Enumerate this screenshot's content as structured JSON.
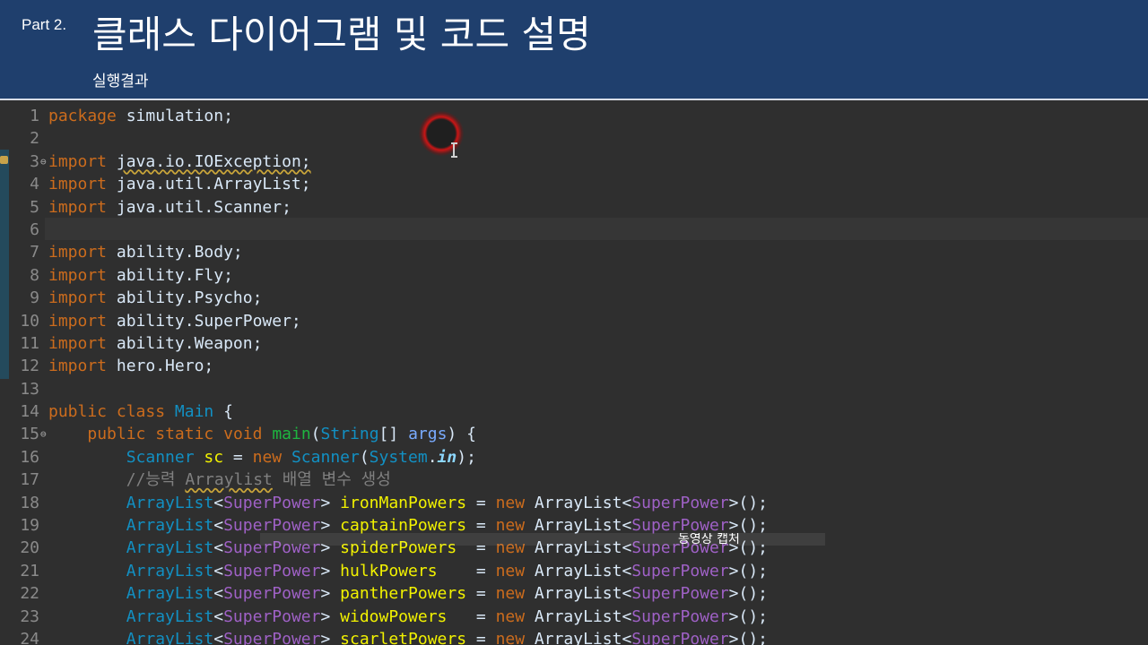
{
  "header": {
    "part_label": "Part 2.",
    "title": "클래스 다이어그램 및 코드 설명",
    "subtitle": "실행결과"
  },
  "caption": "동영상 캡처",
  "colors": {
    "header_bg": "#1f3f6d",
    "editor_bg": "#2f2f2f",
    "keyword": "#cc6c1d",
    "class_name": "#1290c3",
    "generic": "#9f61c6",
    "method": "#1eb540",
    "variable": "#f2f200",
    "comment": "#808080"
  },
  "code_lines": [
    {
      "n": "1",
      "tokens": [
        {
          "t": "package",
          "c": "kw"
        },
        {
          "t": " simulation;",
          "c": "plain"
        }
      ]
    },
    {
      "n": "2",
      "tokens": []
    },
    {
      "n": "3",
      "fold": "⊖",
      "tokens": [
        {
          "t": "import",
          "c": "kw"
        },
        {
          "t": " ",
          "c": "plain"
        },
        {
          "t": "java.io.IOException;",
          "c": "plain warn"
        }
      ]
    },
    {
      "n": "4",
      "tokens": [
        {
          "t": "import",
          "c": "kw"
        },
        {
          "t": " java.util.ArrayList;",
          "c": "plain"
        }
      ]
    },
    {
      "n": "5",
      "tokens": [
        {
          "t": "import",
          "c": "kw"
        },
        {
          "t": " java.util.Scanner;",
          "c": "plain"
        }
      ]
    },
    {
      "n": "6",
      "tokens": []
    },
    {
      "n": "7",
      "tokens": [
        {
          "t": "import",
          "c": "kw"
        },
        {
          "t": " ability.Body;",
          "c": "plain"
        }
      ]
    },
    {
      "n": "8",
      "tokens": [
        {
          "t": "import",
          "c": "kw"
        },
        {
          "t": " ability.Fly;",
          "c": "plain"
        }
      ]
    },
    {
      "n": "9",
      "tokens": [
        {
          "t": "import",
          "c": "kw"
        },
        {
          "t": " ability.Psycho;",
          "c": "plain"
        }
      ]
    },
    {
      "n": "10",
      "tokens": [
        {
          "t": "import",
          "c": "kw"
        },
        {
          "t": " ability.SuperPower;",
          "c": "plain"
        }
      ]
    },
    {
      "n": "11",
      "tokens": [
        {
          "t": "import",
          "c": "kw"
        },
        {
          "t": " ability.Weapon;",
          "c": "plain"
        }
      ]
    },
    {
      "n": "12",
      "tokens": [
        {
          "t": "import",
          "c": "kw"
        },
        {
          "t": " hero.Hero;",
          "c": "plain"
        }
      ]
    },
    {
      "n": "13",
      "tokens": []
    },
    {
      "n": "14",
      "tokens": [
        {
          "t": "public",
          "c": "kw"
        },
        {
          "t": " ",
          "c": "plain"
        },
        {
          "t": "class",
          "c": "kw"
        },
        {
          "t": " ",
          "c": "plain"
        },
        {
          "t": "Main",
          "c": "cls"
        },
        {
          "t": " {",
          "c": "plain"
        }
      ]
    },
    {
      "n": "15",
      "fold": "⊖",
      "tokens": [
        {
          "t": "    ",
          "c": "plain"
        },
        {
          "t": "public",
          "c": "kw"
        },
        {
          "t": " ",
          "c": "plain"
        },
        {
          "t": "static",
          "c": "kw"
        },
        {
          "t": " ",
          "c": "plain"
        },
        {
          "t": "void",
          "c": "kw"
        },
        {
          "t": " ",
          "c": "plain"
        },
        {
          "t": "main",
          "c": "fn"
        },
        {
          "t": "(",
          "c": "plain"
        },
        {
          "t": "String",
          "c": "cls"
        },
        {
          "t": "[] ",
          "c": "plain"
        },
        {
          "t": "args",
          "c": "param"
        },
        {
          "t": ") {",
          "c": "plain"
        }
      ]
    },
    {
      "n": "16",
      "tokens": [
        {
          "t": "        ",
          "c": "plain"
        },
        {
          "t": "Scanner",
          "c": "cls"
        },
        {
          "t": " ",
          "c": "plain"
        },
        {
          "t": "sc",
          "c": "var"
        },
        {
          "t": " = ",
          "c": "plain"
        },
        {
          "t": "new",
          "c": "kw"
        },
        {
          "t": " ",
          "c": "plain"
        },
        {
          "t": "Scanner",
          "c": "cls"
        },
        {
          "t": "(",
          "c": "plain"
        },
        {
          "t": "System",
          "c": "cls"
        },
        {
          "t": ".",
          "c": "plain"
        },
        {
          "t": "in",
          "c": "field"
        },
        {
          "t": ");",
          "c": "plain"
        }
      ]
    },
    {
      "n": "17",
      "tokens": [
        {
          "t": "        ",
          "c": "plain"
        },
        {
          "t": "//능력 ",
          "c": "cmt"
        },
        {
          "t": "Arraylist",
          "c": "cmt warn"
        },
        {
          "t": " 배열 변수 생성",
          "c": "cmt"
        }
      ]
    },
    {
      "n": "18",
      "tokens": [
        {
          "t": "        ",
          "c": "plain"
        },
        {
          "t": "ArrayList",
          "c": "cls"
        },
        {
          "t": "<",
          "c": "plain"
        },
        {
          "t": "SuperPower",
          "c": "gen"
        },
        {
          "t": "> ",
          "c": "plain"
        },
        {
          "t": "ironManPowers",
          "c": "var"
        },
        {
          "t": " = ",
          "c": "plain"
        },
        {
          "t": "new",
          "c": "kw"
        },
        {
          "t": " ArrayList<",
          "c": "plain"
        },
        {
          "t": "SuperPower",
          "c": "gen"
        },
        {
          "t": ">();",
          "c": "plain"
        }
      ]
    },
    {
      "n": "19",
      "tokens": [
        {
          "t": "        ",
          "c": "plain"
        },
        {
          "t": "ArrayList",
          "c": "cls"
        },
        {
          "t": "<",
          "c": "plain"
        },
        {
          "t": "SuperPower",
          "c": "gen"
        },
        {
          "t": "> ",
          "c": "plain"
        },
        {
          "t": "captainPowers",
          "c": "var"
        },
        {
          "t": " = ",
          "c": "plain"
        },
        {
          "t": "new",
          "c": "kw"
        },
        {
          "t": " ArrayList<",
          "c": "plain"
        },
        {
          "t": "SuperPower",
          "c": "gen"
        },
        {
          "t": ">();",
          "c": "plain"
        }
      ]
    },
    {
      "n": "20",
      "tokens": [
        {
          "t": "        ",
          "c": "plain"
        },
        {
          "t": "ArrayList",
          "c": "cls"
        },
        {
          "t": "<",
          "c": "plain"
        },
        {
          "t": "SuperPower",
          "c": "gen"
        },
        {
          "t": "> ",
          "c": "plain"
        },
        {
          "t": "spiderPowers",
          "c": "var"
        },
        {
          "t": "  = ",
          "c": "plain"
        },
        {
          "t": "new",
          "c": "kw"
        },
        {
          "t": " ArrayList<",
          "c": "plain"
        },
        {
          "t": "SuperPower",
          "c": "gen"
        },
        {
          "t": ">();",
          "c": "plain"
        }
      ]
    },
    {
      "n": "21",
      "tokens": [
        {
          "t": "        ",
          "c": "plain"
        },
        {
          "t": "ArrayList",
          "c": "cls"
        },
        {
          "t": "<",
          "c": "plain"
        },
        {
          "t": "SuperPower",
          "c": "gen"
        },
        {
          "t": "> ",
          "c": "plain"
        },
        {
          "t": "hulkPowers",
          "c": "var"
        },
        {
          "t": "    = ",
          "c": "plain"
        },
        {
          "t": "new",
          "c": "kw"
        },
        {
          "t": " ArrayList<",
          "c": "plain"
        },
        {
          "t": "SuperPower",
          "c": "gen"
        },
        {
          "t": ">();",
          "c": "plain"
        }
      ]
    },
    {
      "n": "22",
      "tokens": [
        {
          "t": "        ",
          "c": "plain"
        },
        {
          "t": "ArrayList",
          "c": "cls"
        },
        {
          "t": "<",
          "c": "plain"
        },
        {
          "t": "SuperPower",
          "c": "gen"
        },
        {
          "t": "> ",
          "c": "plain"
        },
        {
          "t": "pantherPowers",
          "c": "var"
        },
        {
          "t": " = ",
          "c": "plain"
        },
        {
          "t": "new",
          "c": "kw"
        },
        {
          "t": " ArrayList<",
          "c": "plain"
        },
        {
          "t": "SuperPower",
          "c": "gen"
        },
        {
          "t": ">();",
          "c": "plain"
        }
      ]
    },
    {
      "n": "23",
      "tokens": [
        {
          "t": "        ",
          "c": "plain"
        },
        {
          "t": "ArrayList",
          "c": "cls"
        },
        {
          "t": "<",
          "c": "plain"
        },
        {
          "t": "SuperPower",
          "c": "gen"
        },
        {
          "t": "> ",
          "c": "plain"
        },
        {
          "t": "widowPowers",
          "c": "var"
        },
        {
          "t": "   = ",
          "c": "plain"
        },
        {
          "t": "new",
          "c": "kw"
        },
        {
          "t": " ArrayList<",
          "c": "plain"
        },
        {
          "t": "SuperPower",
          "c": "gen"
        },
        {
          "t": ">();",
          "c": "plain"
        }
      ]
    },
    {
      "n": "24",
      "tokens": [
        {
          "t": "        ",
          "c": "plain"
        },
        {
          "t": "ArrayList",
          "c": "cls"
        },
        {
          "t": "<",
          "c": "plain"
        },
        {
          "t": "SuperPower",
          "c": "gen"
        },
        {
          "t": "> ",
          "c": "plain"
        },
        {
          "t": "scarletPowers",
          "c": "var"
        },
        {
          "t": " = ",
          "c": "plain"
        },
        {
          "t": "new",
          "c": "kw"
        },
        {
          "t": " ArrayList<",
          "c": "plain"
        },
        {
          "t": "SuperPower",
          "c": "gen"
        },
        {
          "t": ">();",
          "c": "plain"
        }
      ]
    }
  ]
}
